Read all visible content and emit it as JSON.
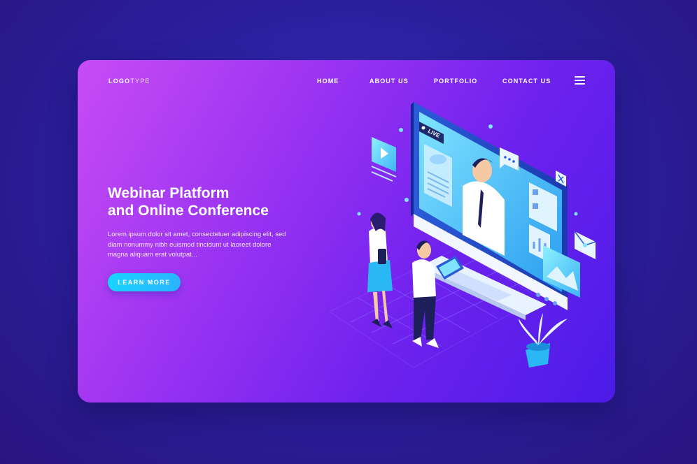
{
  "logo": {
    "bold": "LOGO",
    "light": "TYPE"
  },
  "nav": {
    "items": [
      "HOME",
      "ABOUT US",
      "PORTFOLIO",
      "CONTACT US"
    ]
  },
  "menu_icon": "hamburger-menu-icon",
  "hero": {
    "title_line1": "Webinar Platform",
    "title_line2": "and Online Conference",
    "body": "Lorem ipsum dolor sit amet, consectetuer adipiscing elit, sed diam nonummy nibh euismod tincidunt ut laoreet dolore magna aliquam erat volutpat...",
    "cta_label": "LEARN MORE"
  },
  "illustration": {
    "live_badge": "LIVE"
  },
  "colors": {
    "background": "#2f22a8",
    "card_gradient_start": "#c84cf4",
    "card_gradient_end": "#4b1be8",
    "accent": "#1ecbff"
  }
}
